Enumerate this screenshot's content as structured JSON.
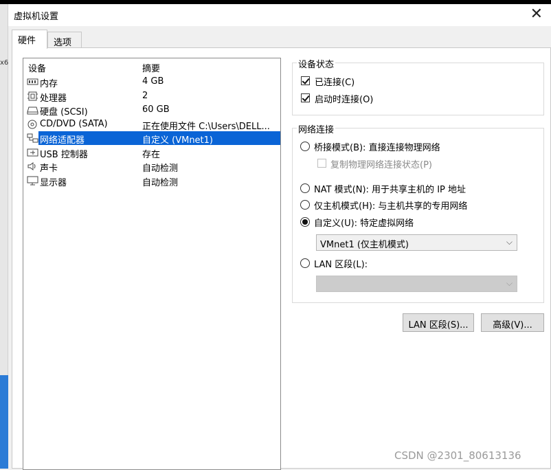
{
  "window": {
    "title": "虚拟机设置",
    "close_glyph": "✕"
  },
  "side": {
    "x6_text": "x6"
  },
  "tabs": [
    {
      "label": "硬件"
    },
    {
      "label": "选项"
    }
  ],
  "devices": {
    "col_device": "设备",
    "col_summary": "摘要",
    "rows": [
      {
        "name": "内存",
        "summary": "4 GB",
        "icon": "memory-icon"
      },
      {
        "name": "处理器",
        "summary": "2",
        "icon": "cpu-icon"
      },
      {
        "name": "硬盘 (SCSI)",
        "summary": "60 GB",
        "icon": "disk-icon"
      },
      {
        "name": "CD/DVD (SATA)",
        "summary": "正在使用文件 C:\\Users\\DELL...",
        "icon": "cd-icon"
      },
      {
        "name": "网络适配器",
        "summary": "自定义 (VMnet1)",
        "icon": "network-icon",
        "selected": true
      },
      {
        "name": "USB 控制器",
        "summary": "存在",
        "icon": "usb-icon"
      },
      {
        "name": "声卡",
        "summary": "自动检测",
        "icon": "sound-icon"
      },
      {
        "name": "显示器",
        "summary": "自动检测",
        "icon": "monitor-icon"
      }
    ]
  },
  "device_status": {
    "legend": "设备状态",
    "connected": {
      "label": "已连接(C)",
      "checked": true
    },
    "connect_on_start": {
      "label": "启动时连接(O)",
      "checked": true
    }
  },
  "network": {
    "legend": "网络连接",
    "bridged": {
      "label": "桥接模式(B): 直接连接物理网络",
      "checked": false
    },
    "replicate": {
      "label": "复制物理网络连接状态(P)",
      "checked": false,
      "disabled": true
    },
    "nat": {
      "label": "NAT 模式(N): 用于共享主机的 IP 地址",
      "checked": false
    },
    "hostonly": {
      "label": "仅主机模式(H): 与主机共享的专用网络",
      "checked": false
    },
    "custom": {
      "label": "自定义(U): 特定虚拟网络",
      "checked": true
    },
    "custom_select": "VMnet1 (仅主机模式)",
    "lan": {
      "label": "LAN 区段(L):",
      "checked": false
    },
    "lan_select": ""
  },
  "buttons": {
    "lan_segments": "LAN 区段(S)...",
    "advanced": "高级(V)..."
  },
  "watermark": "CSDN @2301_80613136",
  "colors": {
    "selection": "#0a64d6",
    "window_bg": "#f0f0f0"
  }
}
